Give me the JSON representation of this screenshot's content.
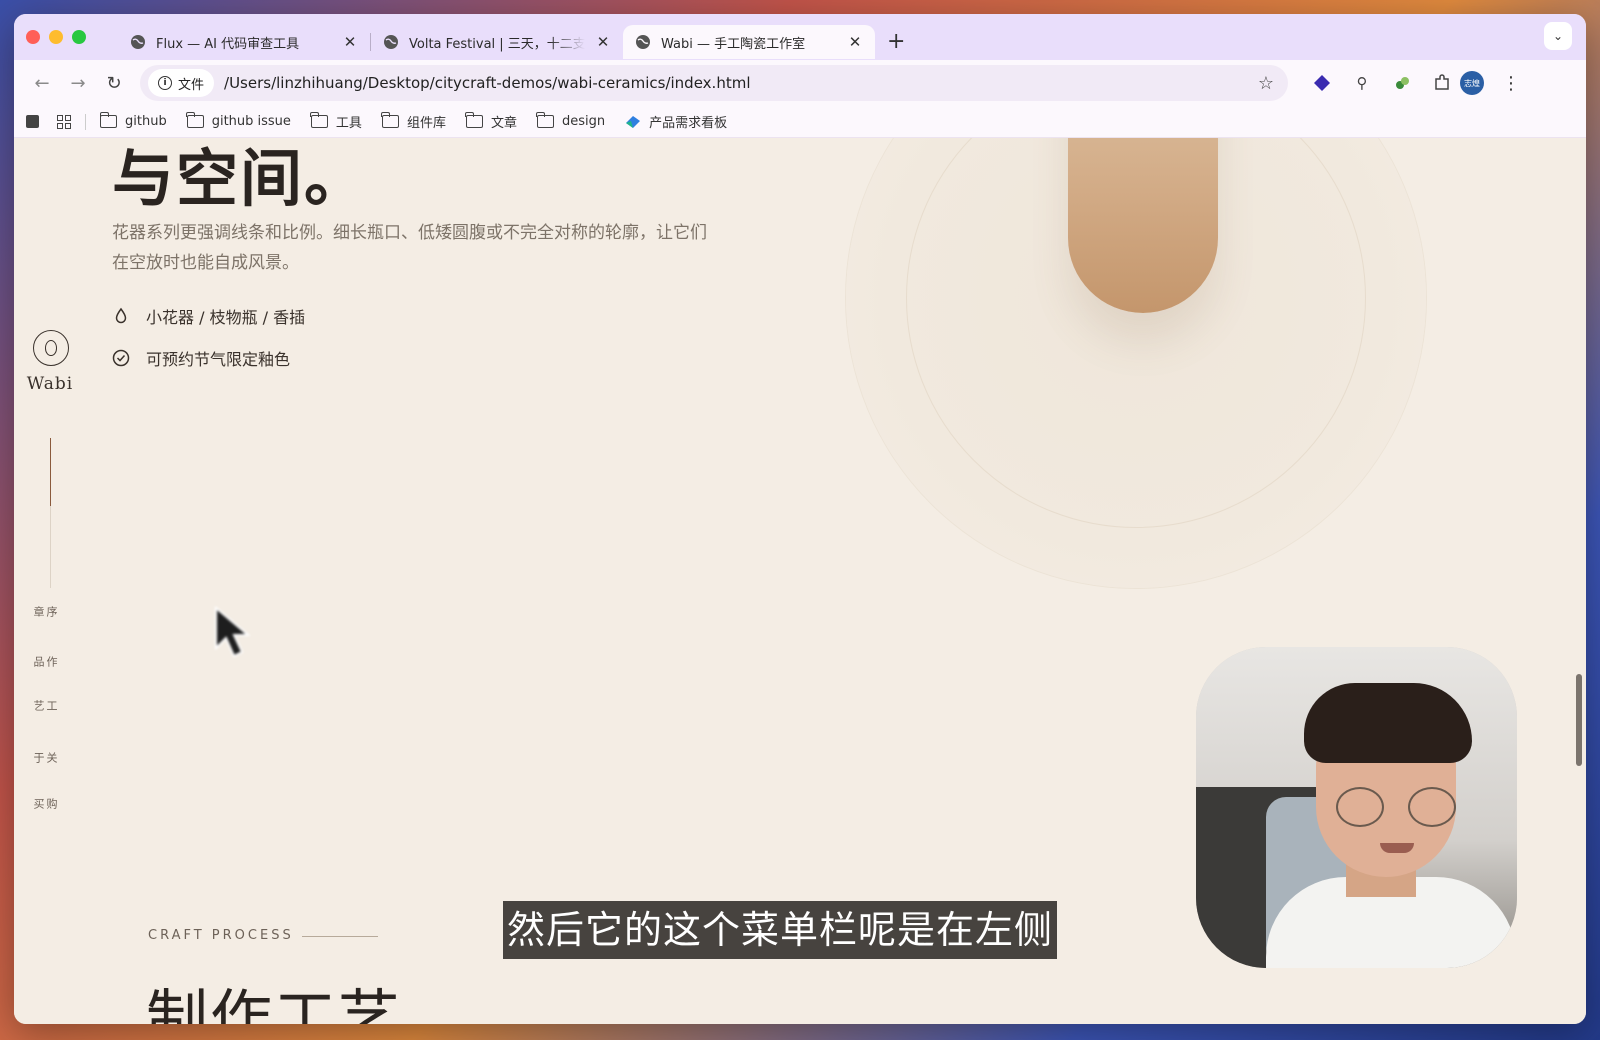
{
  "tabs": [
    {
      "title": "Flux — AI 代码审查工具",
      "active": false
    },
    {
      "title": "Volta Festival | 三天，十二支乐",
      "active": false
    },
    {
      "title": "Wabi — 手工陶瓷工作室",
      "active": true
    }
  ],
  "toolbar": {
    "site_chip": "文件",
    "url": "/Users/linzhihuang/Desktop/citycraft-demos/wabi-ceramics/index.html",
    "profile": "志煌"
  },
  "bookmarks": [
    "github",
    "github issue",
    "工具",
    "组件库",
    "文章",
    "design",
    "产品需求看板"
  ],
  "page": {
    "hero_title": "与空间。",
    "description": "花器系列更强调线条和比例。细长瓶口、低矮圆腹或不完全对称的轮廓，让它们在空放时也能自成风景。",
    "features": [
      "小花器 / 枝物瓶 / 香插",
      "可预约节气限定釉色"
    ],
    "craft_label": "CRAFT PROCESS",
    "craft_title": "制作工艺"
  },
  "sidenav": {
    "logo": "Wabi",
    "progress": 0.45,
    "items": [
      "序章",
      "作品",
      "工艺",
      "关于",
      "购买"
    ]
  },
  "subtitle": "然后它的这个菜单栏呢是在左侧",
  "colors": {
    "accent": "#8a5a3c",
    "background": "#f4ede4",
    "tabstrip": "#e9defb"
  }
}
